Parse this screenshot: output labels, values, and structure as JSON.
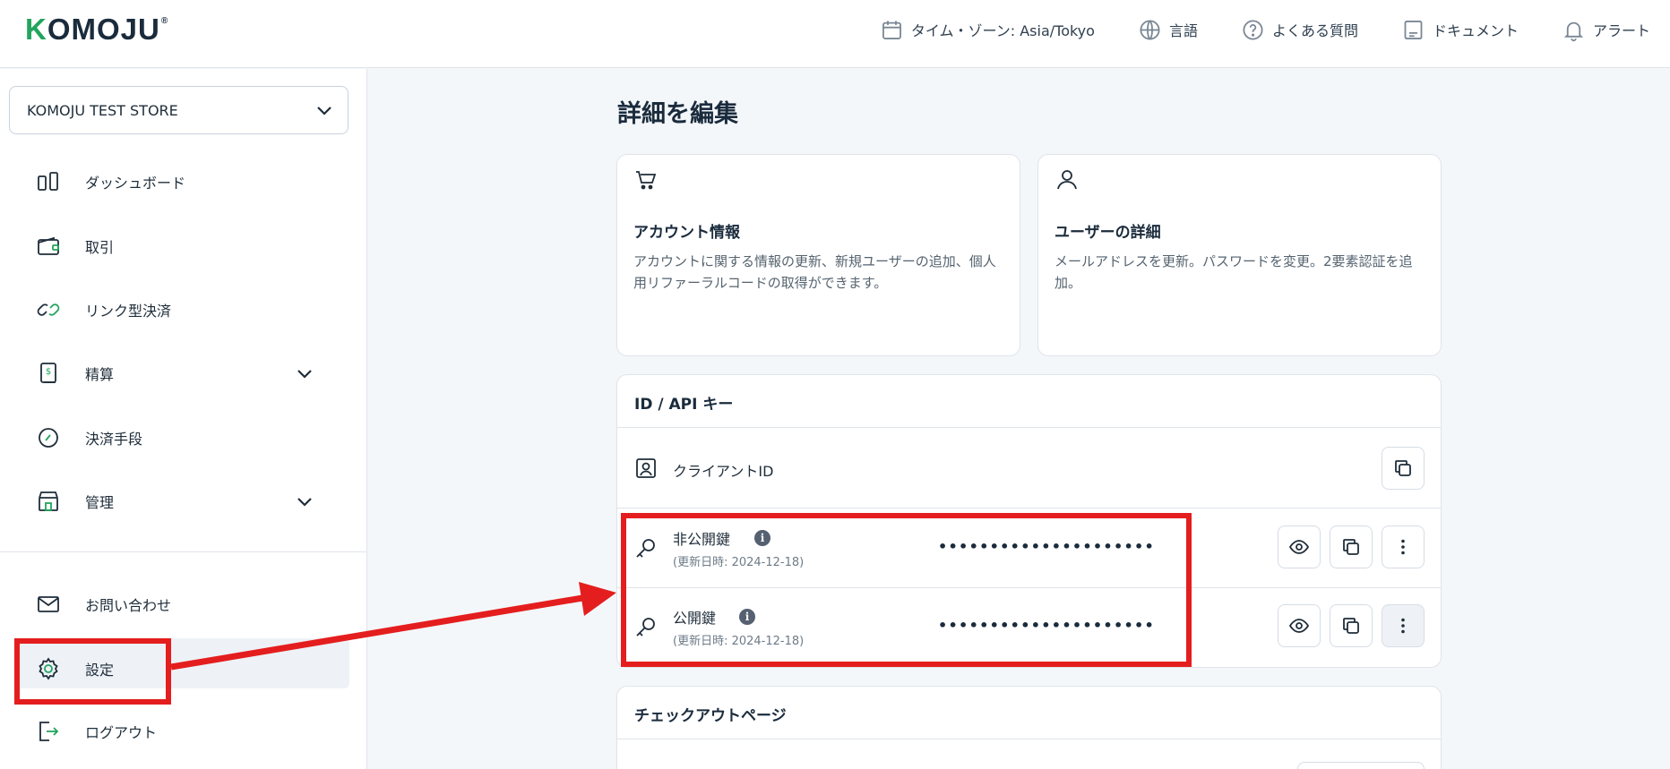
{
  "header": {
    "logo": "KOMOJU",
    "logo_mark": "®",
    "nav": [
      {
        "icon": "calendar-icon",
        "label": "タイム・ゾーン: Asia/Tokyo"
      },
      {
        "icon": "globe-icon",
        "label": "言語"
      },
      {
        "icon": "question-icon",
        "label": "よくある質問"
      },
      {
        "icon": "document-icon",
        "label": "ドキュメント"
      },
      {
        "icon": "bell-icon",
        "label": "アラート"
      }
    ]
  },
  "sidebar": {
    "store_name": "KOMOJU TEST STORE",
    "items": [
      {
        "icon": "dashboard-icon",
        "label": "ダッシュボード"
      },
      {
        "icon": "wallet-icon",
        "label": "取引"
      },
      {
        "icon": "link-icon",
        "label": "リンク型決済"
      },
      {
        "icon": "invoice-icon",
        "label": "精算"
      },
      {
        "icon": "gauge-icon",
        "label": "決済手段"
      },
      {
        "icon": "store-icon",
        "label": "管理"
      }
    ],
    "bottom_items": [
      {
        "icon": "mail-icon",
        "label": "お問い合わせ"
      },
      {
        "icon": "gear-icon",
        "label": "設定"
      },
      {
        "icon": "logout-icon",
        "label": "ログアウト"
      }
    ]
  },
  "main": {
    "title": "詳細を編集",
    "cards": [
      {
        "icon": "cart-icon",
        "title": "アカウント情報",
        "desc": "アカウントに関する情報の更新、新規ユーザーの追加、個人用リファーラルコードの取得ができます。"
      },
      {
        "icon": "user-icon",
        "title": "ユーザーの詳細",
        "desc": "メールアドレスを更新。パスワードを変更。2要素認証を追加。"
      }
    ],
    "api": {
      "title": "ID / API キー",
      "client_id_label": "クライアントID",
      "secret_key": {
        "label": "非公開鍵",
        "updated": "(更新日時: 2024-12-18)",
        "masked": "•••••••••••••••••••••"
      },
      "public_key": {
        "label": "公開鍵",
        "updated": "(更新日時: 2024-12-18)",
        "masked": "•••••••••••••••••••••"
      },
      "info_glyph": "i"
    },
    "checkout_title": "チェックアウトページ"
  },
  "colors": {
    "brand_green": "#22a45d",
    "annotation_red": "#e41e1e",
    "text_dark": "#1a2b3c"
  }
}
